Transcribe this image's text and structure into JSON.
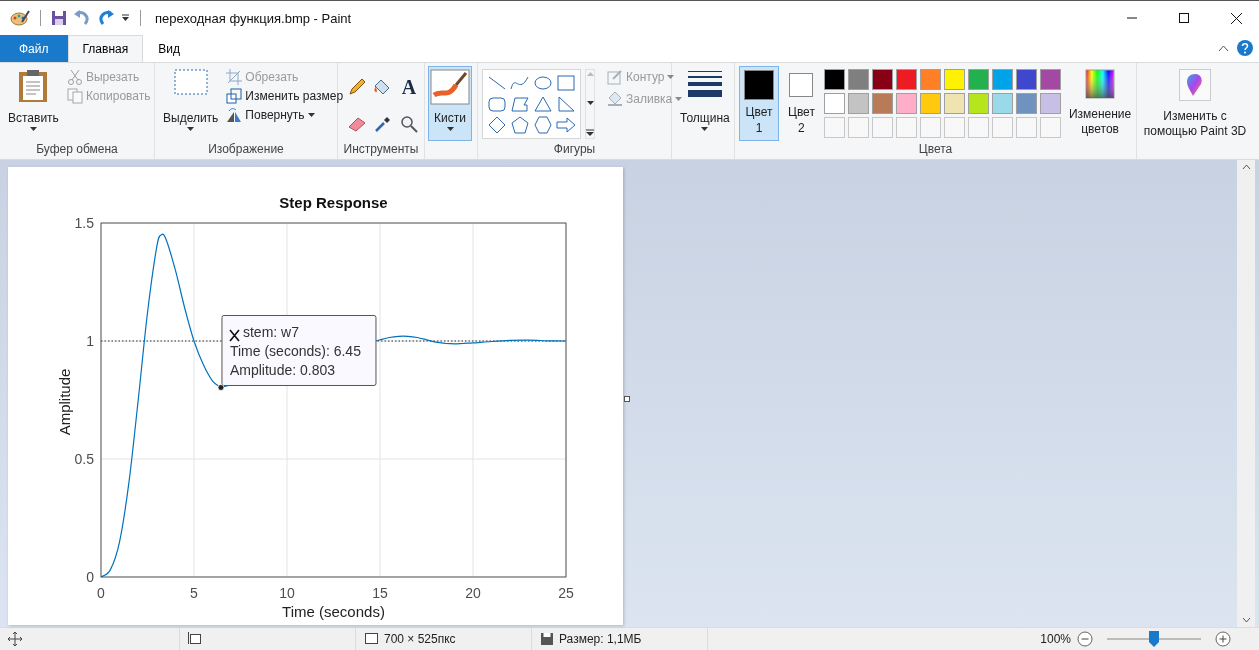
{
  "window": {
    "title": "переходная функция.bmp - Paint"
  },
  "tabs": [
    {
      "label": "Файл",
      "kind": "file",
      "selected": false
    },
    {
      "label": "Главная",
      "kind": "tab",
      "selected": true
    },
    {
      "label": "Вид",
      "kind": "tab",
      "selected": false
    }
  ],
  "ribbon": {
    "clipboard": {
      "label": "Буфер обмена",
      "paste": "Вставить",
      "cut": {
        "label": "Вырезать",
        "disabled": true
      },
      "copy": {
        "label": "Копировать",
        "disabled": true
      }
    },
    "image": {
      "label": "Изображение",
      "select": "Выделить",
      "crop": {
        "label": "Обрезать",
        "disabled": true
      },
      "resize": {
        "label": "Изменить размер",
        "disabled": false
      },
      "rotate": {
        "label": "Повернуть",
        "disabled": false
      }
    },
    "tools": {
      "label": "Инструменты",
      "text_tool": "A"
    },
    "brushes": {
      "label": "Кисти",
      "selected": true
    },
    "shapes": {
      "label": "Фигуры",
      "outline": {
        "label": "Контур",
        "disabled": true
      },
      "fill": {
        "label": "Заливка",
        "disabled": true
      }
    },
    "size": {
      "label": "Толщина"
    },
    "colors": {
      "label": "Цвета",
      "color_1": {
        "lines": [
          "Цвет",
          "1"
        ],
        "color": "#000000",
        "selected": true
      },
      "color_2": {
        "lines": [
          "Цвет",
          "2"
        ],
        "color": "#ffffff",
        "selected": false
      },
      "palette": [
        {
          "color": "#000000"
        },
        {
          "color": "#7f7f7f"
        },
        {
          "color": "#880015"
        },
        {
          "color": "#ed1c24"
        },
        {
          "color": "#ff7f27"
        },
        {
          "color": "#fff200"
        },
        {
          "color": "#22b14c"
        },
        {
          "color": "#00a2e8"
        },
        {
          "color": "#3f48cc"
        },
        {
          "color": "#a349a4"
        },
        {
          "color": "#ffffff"
        },
        {
          "color": "#c3c3c3"
        },
        {
          "color": "#b97a57"
        },
        {
          "color": "#ffaec9"
        },
        {
          "color": "#ffc90e"
        },
        {
          "color": "#efe4b0"
        },
        {
          "color": "#b5e61d"
        },
        {
          "color": "#99d9ea"
        },
        {
          "color": "#7092be"
        },
        {
          "color": "#c8bfe7"
        }
      ],
      "edit_colors": [
        "Изменение",
        "цветов"
      ]
    },
    "paint3d": {
      "lines": [
        "Изменить с",
        "помощью Paint 3D"
      ]
    }
  },
  "canvas": {
    "chart_data": {
      "type": "line",
      "title": "Step Response",
      "xlabel": "Time (seconds)",
      "ylabel": "Amplitude",
      "xlim": [
        0,
        25
      ],
      "ylim": [
        0,
        1.5
      ],
      "xticks": [
        0,
        5,
        10,
        15,
        20,
        25
      ],
      "yticks": [
        0,
        0.5,
        1,
        1.5
      ],
      "grid": true,
      "x": [
        0,
        0.5,
        1,
        1.5,
        2,
        2.5,
        3,
        3.25,
        3.5,
        4,
        4.5,
        5,
        5.5,
        6,
        6.45,
        15,
        15.5,
        16,
        16.5,
        17,
        17.5,
        18,
        18.5,
        19,
        19.5,
        20,
        21,
        22,
        23,
        24,
        25
      ],
      "series": [
        {
          "color": "#0072bd",
          "values": [
            0,
            0.03,
            0.15,
            0.4,
            0.75,
            1.12,
            1.4,
            1.45,
            1.43,
            1.3,
            1.14,
            1.0,
            0.9,
            0.83,
            0.803,
            1.005,
            1.015,
            1.02,
            1.02,
            1.015,
            1.005,
            0.995,
            0.99,
            0.988,
            0.99,
            0.992,
            0.998,
            1.003,
            1.004,
            1.001,
            1.0
          ]
        }
      ],
      "ref_lines": [
        {
          "axis": "y",
          "value": 1
        }
      ],
      "annotations": [
        {
          "x": 6.45,
          "y": 0.803,
          "text": "stem: w7\nTime (seconds): 6.45\nAmplitude: 0.803"
        }
      ]
    }
  },
  "status_bar": {
    "dimensions": "700 × 525пкс",
    "file_size": "Размер: 1,1МБ",
    "zoom": "100%",
    "zoom_slider": {
      "level": 0.5
    }
  }
}
